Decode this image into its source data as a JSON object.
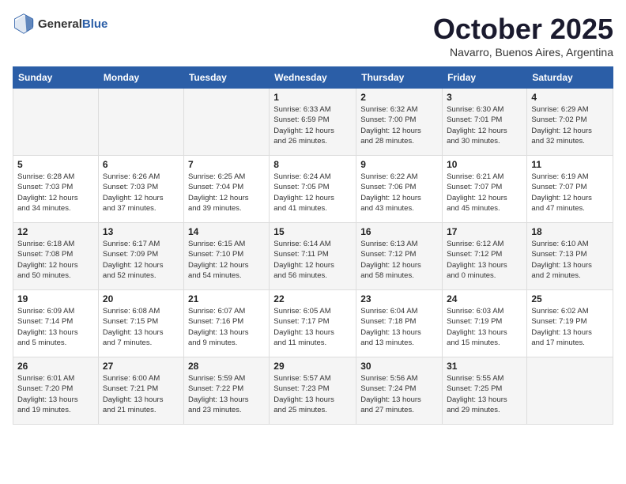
{
  "header": {
    "logo_general": "General",
    "logo_blue": "Blue",
    "month_title": "October 2025",
    "location": "Navarro, Buenos Aires, Argentina"
  },
  "days_of_week": [
    "Sunday",
    "Monday",
    "Tuesday",
    "Wednesday",
    "Thursday",
    "Friday",
    "Saturday"
  ],
  "weeks": [
    [
      {
        "day": "",
        "info": ""
      },
      {
        "day": "",
        "info": ""
      },
      {
        "day": "",
        "info": ""
      },
      {
        "day": "1",
        "info": "Sunrise: 6:33 AM\nSunset: 6:59 PM\nDaylight: 12 hours\nand 26 minutes."
      },
      {
        "day": "2",
        "info": "Sunrise: 6:32 AM\nSunset: 7:00 PM\nDaylight: 12 hours\nand 28 minutes."
      },
      {
        "day": "3",
        "info": "Sunrise: 6:30 AM\nSunset: 7:01 PM\nDaylight: 12 hours\nand 30 minutes."
      },
      {
        "day": "4",
        "info": "Sunrise: 6:29 AM\nSunset: 7:02 PM\nDaylight: 12 hours\nand 32 minutes."
      }
    ],
    [
      {
        "day": "5",
        "info": "Sunrise: 6:28 AM\nSunset: 7:03 PM\nDaylight: 12 hours\nand 34 minutes."
      },
      {
        "day": "6",
        "info": "Sunrise: 6:26 AM\nSunset: 7:03 PM\nDaylight: 12 hours\nand 37 minutes."
      },
      {
        "day": "7",
        "info": "Sunrise: 6:25 AM\nSunset: 7:04 PM\nDaylight: 12 hours\nand 39 minutes."
      },
      {
        "day": "8",
        "info": "Sunrise: 6:24 AM\nSunset: 7:05 PM\nDaylight: 12 hours\nand 41 minutes."
      },
      {
        "day": "9",
        "info": "Sunrise: 6:22 AM\nSunset: 7:06 PM\nDaylight: 12 hours\nand 43 minutes."
      },
      {
        "day": "10",
        "info": "Sunrise: 6:21 AM\nSunset: 7:07 PM\nDaylight: 12 hours\nand 45 minutes."
      },
      {
        "day": "11",
        "info": "Sunrise: 6:19 AM\nSunset: 7:07 PM\nDaylight: 12 hours\nand 47 minutes."
      }
    ],
    [
      {
        "day": "12",
        "info": "Sunrise: 6:18 AM\nSunset: 7:08 PM\nDaylight: 12 hours\nand 50 minutes."
      },
      {
        "day": "13",
        "info": "Sunrise: 6:17 AM\nSunset: 7:09 PM\nDaylight: 12 hours\nand 52 minutes."
      },
      {
        "day": "14",
        "info": "Sunrise: 6:15 AM\nSunset: 7:10 PM\nDaylight: 12 hours\nand 54 minutes."
      },
      {
        "day": "15",
        "info": "Sunrise: 6:14 AM\nSunset: 7:11 PM\nDaylight: 12 hours\nand 56 minutes."
      },
      {
        "day": "16",
        "info": "Sunrise: 6:13 AM\nSunset: 7:12 PM\nDaylight: 12 hours\nand 58 minutes."
      },
      {
        "day": "17",
        "info": "Sunrise: 6:12 AM\nSunset: 7:12 PM\nDaylight: 13 hours\nand 0 minutes."
      },
      {
        "day": "18",
        "info": "Sunrise: 6:10 AM\nSunset: 7:13 PM\nDaylight: 13 hours\nand 2 minutes."
      }
    ],
    [
      {
        "day": "19",
        "info": "Sunrise: 6:09 AM\nSunset: 7:14 PM\nDaylight: 13 hours\nand 5 minutes."
      },
      {
        "day": "20",
        "info": "Sunrise: 6:08 AM\nSunset: 7:15 PM\nDaylight: 13 hours\nand 7 minutes."
      },
      {
        "day": "21",
        "info": "Sunrise: 6:07 AM\nSunset: 7:16 PM\nDaylight: 13 hours\nand 9 minutes."
      },
      {
        "day": "22",
        "info": "Sunrise: 6:05 AM\nSunset: 7:17 PM\nDaylight: 13 hours\nand 11 minutes."
      },
      {
        "day": "23",
        "info": "Sunrise: 6:04 AM\nSunset: 7:18 PM\nDaylight: 13 hours\nand 13 minutes."
      },
      {
        "day": "24",
        "info": "Sunrise: 6:03 AM\nSunset: 7:19 PM\nDaylight: 13 hours\nand 15 minutes."
      },
      {
        "day": "25",
        "info": "Sunrise: 6:02 AM\nSunset: 7:19 PM\nDaylight: 13 hours\nand 17 minutes."
      }
    ],
    [
      {
        "day": "26",
        "info": "Sunrise: 6:01 AM\nSunset: 7:20 PM\nDaylight: 13 hours\nand 19 minutes."
      },
      {
        "day": "27",
        "info": "Sunrise: 6:00 AM\nSunset: 7:21 PM\nDaylight: 13 hours\nand 21 minutes."
      },
      {
        "day": "28",
        "info": "Sunrise: 5:59 AM\nSunset: 7:22 PM\nDaylight: 13 hours\nand 23 minutes."
      },
      {
        "day": "29",
        "info": "Sunrise: 5:57 AM\nSunset: 7:23 PM\nDaylight: 13 hours\nand 25 minutes."
      },
      {
        "day": "30",
        "info": "Sunrise: 5:56 AM\nSunset: 7:24 PM\nDaylight: 13 hours\nand 27 minutes."
      },
      {
        "day": "31",
        "info": "Sunrise: 5:55 AM\nSunset: 7:25 PM\nDaylight: 13 hours\nand 29 minutes."
      },
      {
        "day": "",
        "info": ""
      }
    ]
  ]
}
